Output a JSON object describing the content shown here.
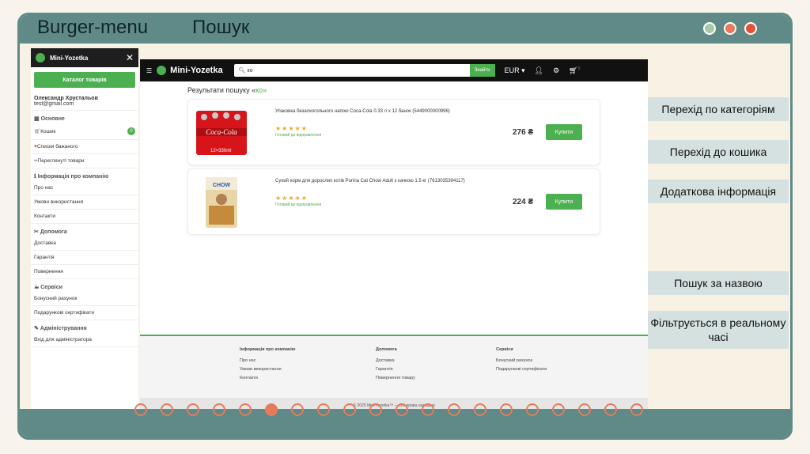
{
  "slide": {
    "title_left": "Burger-menu",
    "title_right": "Пошук",
    "dot_colors": [
      "#a8c8a8",
      "#e67a5a",
      "#e0533a"
    ],
    "pager_count": 20,
    "pager_active": 5
  },
  "sidebar": {
    "brand": "Mini-Yozetka",
    "close": "✕",
    "catalog_button": "Каталог товарів",
    "user_name": "Олександр Хрустальов",
    "user_email": "test@gmail.com",
    "sections": [
      {
        "title": "Основне",
        "icon": "grid-icon",
        "items": [
          {
            "label": "Кошик",
            "icon": "cart-icon",
            "badge": "0"
          },
          {
            "label": "Списки бажаного",
            "icon": "heart-icon"
          },
          {
            "label": "Переглянуті товари",
            "icon": "eye-icon"
          }
        ]
      },
      {
        "title": "Інформація про компанію",
        "icon": "info-icon",
        "items": [
          {
            "label": "Про нас"
          },
          {
            "label": "Умови використання"
          },
          {
            "label": "Контакти"
          }
        ]
      },
      {
        "title": "Допомога",
        "icon": "tools-icon",
        "items": [
          {
            "label": "Доставка"
          },
          {
            "label": "Гарантія"
          },
          {
            "label": "Повернення"
          }
        ]
      },
      {
        "title": "Сервіси",
        "icon": "services-icon",
        "items": [
          {
            "label": "Бонусний рахунок"
          },
          {
            "label": "Подарункові сертифікати"
          }
        ]
      },
      {
        "title": "Адміністрування",
        "icon": "admin-icon",
        "items": [
          {
            "label": "Вхід для адміністратора"
          }
        ]
      }
    ]
  },
  "site": {
    "brand": "Mini-Yozetka",
    "search_value": "ко",
    "search_button": "Знайти",
    "currency": "EUR",
    "cart_count": "0",
    "results_prefix": "Результати пошуку «",
    "results_query": "ко",
    "results_suffix": "»",
    "products": [
      {
        "name": "Упаковка безалкогольного напою Coca-Cola 0.33 л x 12 банок (5449000000996)",
        "rating": "★★★★★",
        "status": "Готовий до відправлення",
        "price": "276 ₴",
        "buy": "Купити"
      },
      {
        "name": "Сухий корм для дорослих котів Purina Cat Chow Adult з качкою 1.5 кг (7613035394117)",
        "rating": "★★★★★",
        "status": "Готовий до відправлення",
        "price": "224 ₴",
        "buy": "Купити"
      }
    ],
    "footer": {
      "cols": [
        {
          "title": "Інформація про компанію",
          "items": [
            "Про нас",
            "Умови використання",
            "Контакти"
          ]
        },
        {
          "title": "Допомога",
          "items": [
            "Доставка",
            "Гарантія",
            "Повернення товару"
          ]
        },
        {
          "title": "Сервіси",
          "items": [
            "Бонусний рахунок",
            "Подарункові сертифікати"
          ]
        }
      ],
      "copyright": "© 2025 Mini-Yozetka™ — Всі права захищені"
    }
  },
  "labels": [
    "Перехід по категоріям",
    "Перехід до кошика",
    "Додаткова інформація",
    "Пошук за назвою",
    "Фільтрується в реальному часі"
  ]
}
